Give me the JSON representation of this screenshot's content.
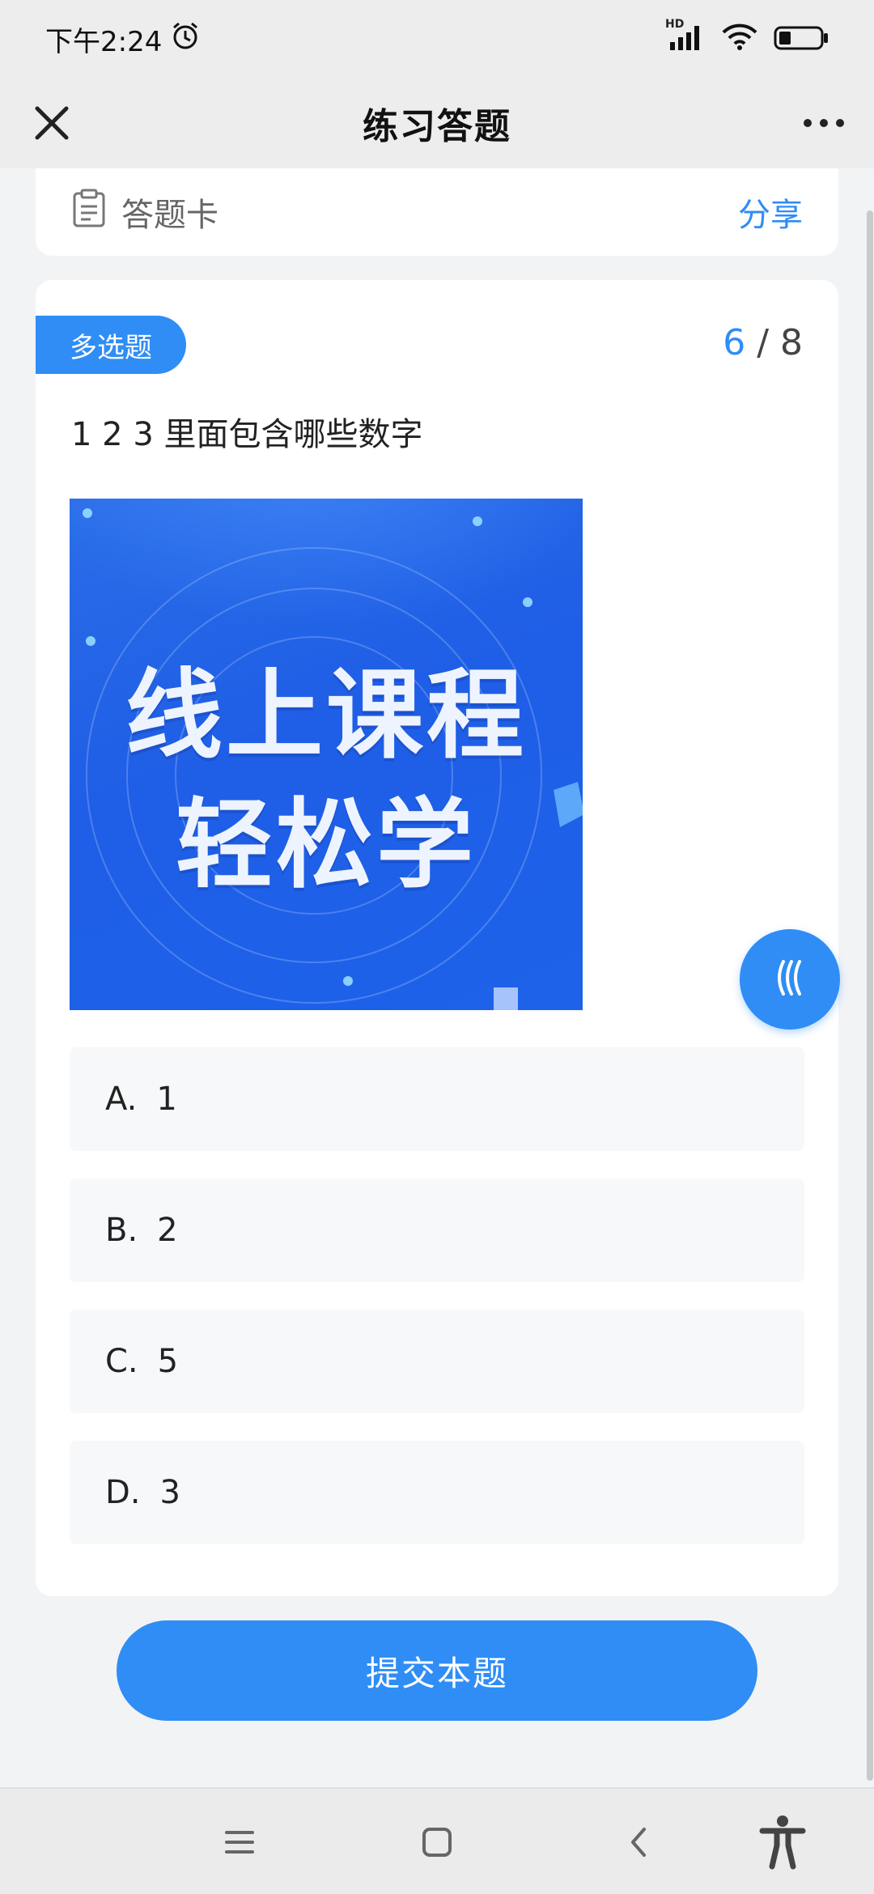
{
  "status_bar": {
    "time": "下午2:24",
    "network": "HD"
  },
  "header": {
    "title": "练习答题"
  },
  "answer_card": {
    "label": "答题卡",
    "share_label": "分享"
  },
  "question": {
    "type_label": "多选题",
    "current": "6",
    "separator": " / ",
    "total": "8",
    "text": "1 2 3 里面包含哪些数字",
    "image_text_line1": "线上课程",
    "image_text_line2": "轻松学",
    "options": [
      {
        "letter": "A.",
        "text": "1"
      },
      {
        "letter": "B.",
        "text": "2"
      },
      {
        "letter": "C.",
        "text": "5"
      },
      {
        "letter": "D.",
        "text": "3"
      }
    ]
  },
  "submit_label": "提交本题",
  "colors": {
    "accent": "#2f8df5",
    "background": "#f2f3f5",
    "option_bg": "#f7f8fa"
  },
  "icons": {
    "close": "close-icon",
    "more": "more-icon",
    "clipboard": "clipboard-icon",
    "float": "chevrons-left-icon",
    "menu": "menu-icon",
    "home": "home-icon",
    "back": "back-icon",
    "accessibility": "accessibility-icon"
  }
}
